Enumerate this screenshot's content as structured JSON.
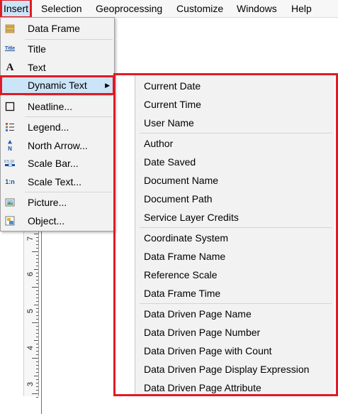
{
  "menubar": {
    "items": [
      "Insert",
      "Selection",
      "Geoprocessing",
      "Customize",
      "Windows",
      "Help"
    ]
  },
  "insert_menu": {
    "items": [
      {
        "label": "Data Frame",
        "icon": "data-frame-icon"
      },
      {
        "label": "Title",
        "icon": "title-icon",
        "icon_text": "Title"
      },
      {
        "label": "Text",
        "icon": "text-icon",
        "icon_text": "A"
      },
      {
        "label": "Dynamic Text",
        "icon": "",
        "has_submenu": true
      },
      {
        "label": "Neatline...",
        "icon": "neatline-icon"
      },
      {
        "label": "Legend...",
        "icon": "legend-icon"
      },
      {
        "label": "North Arrow...",
        "icon": "north-arrow-icon",
        "icon_text": "N"
      },
      {
        "label": "Scale Bar...",
        "icon": "scale-bar-icon"
      },
      {
        "label": "Scale Text...",
        "icon": "scale-text-icon",
        "icon_text": "1:n"
      },
      {
        "label": "Picture...",
        "icon": "picture-icon"
      },
      {
        "label": "Object...",
        "icon": "object-icon"
      }
    ]
  },
  "dynamic_text_submenu": {
    "items": [
      "Current Date",
      "Current Time",
      "User Name",
      "Author",
      "Date Saved",
      "Document Name",
      "Document Path",
      "Service Layer Credits",
      "Coordinate System",
      "Data Frame Name",
      "Reference Scale",
      "Data Frame Time",
      "Data Driven Page Name",
      "Data Driven Page Number",
      "Data Driven Page with Count",
      "Data Driven Page Display Expression",
      "Data Driven Page Attribute"
    ]
  },
  "ruler": {
    "labels": [
      "7",
      "6",
      "5",
      "4",
      "3"
    ]
  },
  "colors": {
    "highlight": "#cce4f7",
    "annotation_red": "#e01b24",
    "menu_bg": "#f2f2f2"
  }
}
